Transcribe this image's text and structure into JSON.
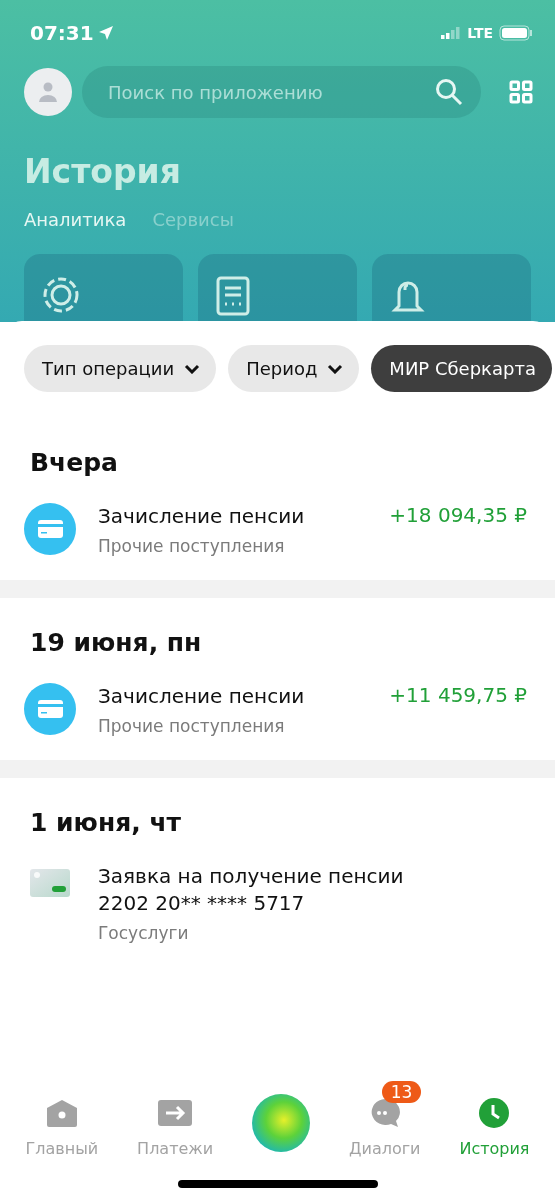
{
  "status_bar": {
    "time": "07:31",
    "network": "LTE"
  },
  "search": {
    "placeholder": "Поиск по приложению"
  },
  "title": "История",
  "tabs": [
    {
      "label": "Аналитика",
      "selected": true
    },
    {
      "label": "Сервисы",
      "selected": false
    }
  ],
  "tiles": [
    {
      "kind": "ring"
    },
    {
      "kind": "document"
    },
    {
      "kind": "bell"
    }
  ],
  "filters": [
    {
      "label": "Тип операции",
      "kind": "dropdown",
      "selected": false
    },
    {
      "label": "Период",
      "kind": "dropdown",
      "selected": false
    },
    {
      "label": "МИР Сберкарта",
      "kind": "plain",
      "selected": true
    }
  ],
  "groups": [
    {
      "date": "Вчера",
      "transactions": [
        {
          "kind": "card",
          "title": "Зачисление пенсии",
          "subtitle": "Прочие поступления",
          "amount": "+18 094,35 ₽"
        }
      ]
    },
    {
      "date": "19 июня, пн",
      "transactions": [
        {
          "kind": "card",
          "title": "Зачисление пенсии",
          "subtitle": "Прочие поступления",
          "amount": "+11 459,75 ₽"
        }
      ]
    },
    {
      "date": "1 июня, чт",
      "transactions": [
        {
          "kind": "card-image",
          "title": "Заявка на получение пенсии",
          "detail": "2202 20** **** 5717",
          "subtitle": "Госуслуги"
        }
      ]
    }
  ],
  "nav": [
    {
      "kind": "home",
      "label": "Главный",
      "selected": false
    },
    {
      "kind": "payments",
      "label": "Платежи",
      "selected": false
    },
    {
      "kind": "assistant",
      "selected": false
    },
    {
      "kind": "dialogs",
      "label": "Диалоги",
      "selected": false,
      "badge": "13"
    },
    {
      "kind": "history",
      "label": "История",
      "selected": true
    }
  ]
}
